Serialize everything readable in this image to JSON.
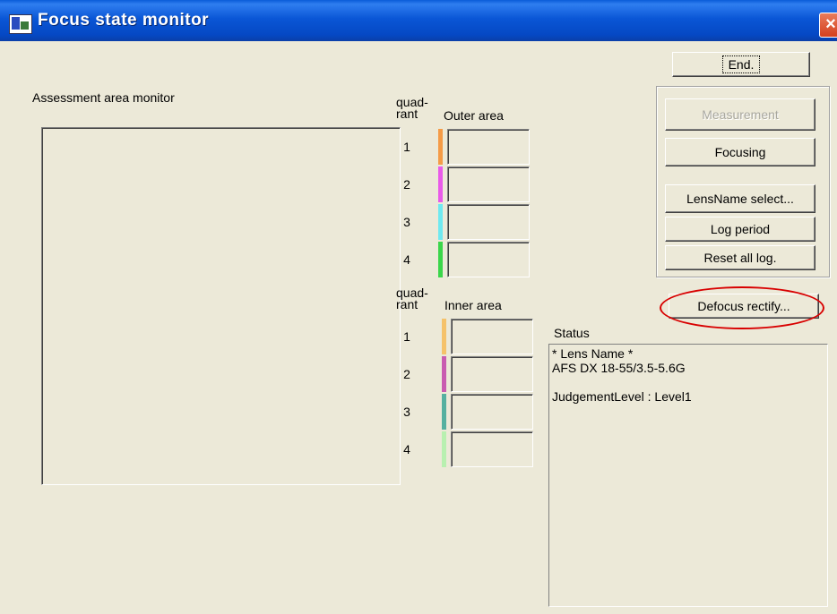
{
  "window": {
    "title": "Focus state monitor",
    "close_icon": "×"
  },
  "assessment": {
    "label": "Assessment area monitor"
  },
  "outer": {
    "quadrant_header_1": "quad-",
    "quadrant_header_2": "rant",
    "area_label": "Outer area",
    "rows": [
      {
        "num": "1",
        "color": "#f59b47"
      },
      {
        "num": "2",
        "color": "#e95ae9"
      },
      {
        "num": "3",
        "color": "#6fe9f0"
      },
      {
        "num": "4",
        "color": "#3bd64a"
      }
    ]
  },
  "inner": {
    "quadrant_header_1": "quad-",
    "quadrant_header_2": "rant",
    "area_label": "Inner area",
    "rows": [
      {
        "num": "1",
        "color": "#f5c26a"
      },
      {
        "num": "2",
        "color": "#c95bb0"
      },
      {
        "num": "3",
        "color": "#55b0a0"
      },
      {
        "num": "4",
        "color": "#b8f0b0"
      }
    ]
  },
  "buttons": {
    "end": "End.",
    "measurement": "Measurement",
    "focusing": "Focusing",
    "lensname_select": "LensName select...",
    "log_period": "Log period",
    "reset_all_log": "Reset all log.",
    "defocus_rectify": "Defocus rectify..."
  },
  "status": {
    "label": "Status",
    "text": "* Lens Name *\nAFS DX 18-55/3.5-5.6G\n\nJudgementLevel : Level1"
  }
}
